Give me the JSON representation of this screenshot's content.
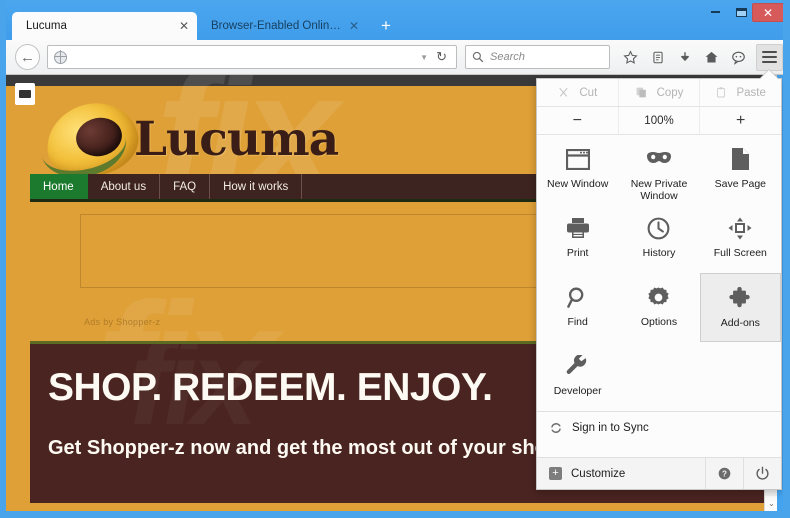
{
  "window": {
    "buttons": {
      "minimize": "–",
      "maximize": "□",
      "close": "✕"
    }
  },
  "tabs": [
    {
      "title": "Lucuma",
      "close": "✕",
      "active": true
    },
    {
      "title": "Browser-Enabled Online Advert...",
      "close": "✕",
      "active": false
    }
  ],
  "new_tab_label": "+",
  "toolbar": {
    "back": "←",
    "url_value": "",
    "url_placeholder": "",
    "url_dropdown": "▼",
    "reload": "↻",
    "search_placeholder": "Search",
    "icons": [
      "bookmark-star-icon",
      "reading-list-icon",
      "downloads-icon",
      "home-icon",
      "chat-icon"
    ],
    "menu": "hamburger-menu-icon"
  },
  "menu": {
    "edit_row": [
      {
        "label": "Cut",
        "icon": "scissors-icon",
        "disabled": true
      },
      {
        "label": "Copy",
        "icon": "copy-icon",
        "disabled": true
      },
      {
        "label": "Paste",
        "icon": "clipboard-icon",
        "disabled": true
      }
    ],
    "zoom_row": {
      "minus": "−",
      "level": "100%",
      "plus": "+"
    },
    "grid": [
      {
        "label": "New Window",
        "icon": "window-icon",
        "highlighted": false
      },
      {
        "label": "New Private Window",
        "icon": "mask-icon",
        "highlighted": false
      },
      {
        "label": "Save Page",
        "icon": "page-icon",
        "highlighted": false
      },
      {
        "label": "Print",
        "icon": "printer-icon",
        "highlighted": false
      },
      {
        "label": "History",
        "icon": "clock-icon",
        "highlighted": false
      },
      {
        "label": "Full Screen",
        "icon": "fullscreen-icon",
        "highlighted": false
      },
      {
        "label": "Find",
        "icon": "magnifier-icon",
        "highlighted": false
      },
      {
        "label": "Options",
        "icon": "gear-icon",
        "highlighted": false
      },
      {
        "label": "Add-ons",
        "icon": "puzzle-icon",
        "highlighted": true
      },
      {
        "label": "Developer",
        "icon": "wrench-icon",
        "highlighted": false
      }
    ],
    "sync": {
      "label": "Sign in to Sync",
      "icon": "sync-icon"
    },
    "customize": {
      "label": "Customize",
      "icon": "plus-square-icon"
    },
    "help": "?",
    "quit": "⏻"
  },
  "site": {
    "badge": "adblock-badge-icon",
    "logo_text": "Lucuma",
    "nav": [
      {
        "label": "Home",
        "active": true
      },
      {
        "label": "About us",
        "active": false
      },
      {
        "label": "FAQ",
        "active": false
      },
      {
        "label": "How it works",
        "active": false
      }
    ],
    "ads_by": "Ads by Shopper-z",
    "hero_title": "SHOP. REDEEM. ENJOY.",
    "hero_sub": "Get Shopper-z now and get the most out of your shopping experience!",
    "watermark": "fix",
    "scroll_down": "⌄"
  },
  "colors": {
    "chrome_blue": "#45a3ee",
    "close_red": "#d75a5a",
    "site_orange": "#dfa037",
    "nav_brown": "#3e2420",
    "nav_active_green": "#1c7a2e",
    "hero_brown": "#4a2420",
    "menu_bg": "#fcfcfc",
    "highlight_gray": "#ededed"
  }
}
